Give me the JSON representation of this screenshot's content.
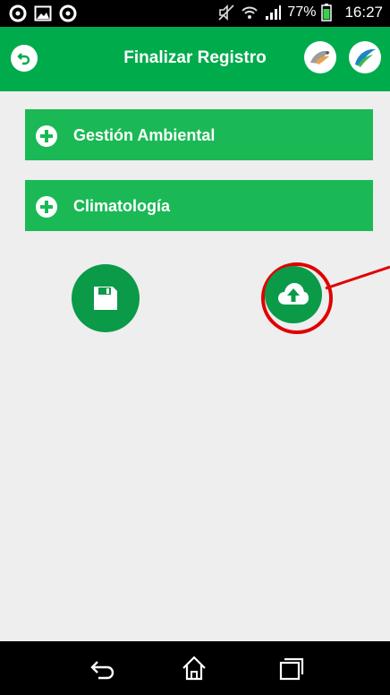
{
  "status_bar": {
    "battery_percent": "77%",
    "time": "16:27",
    "icons": [
      "notification-icon",
      "image-icon",
      "notification-icon",
      "muted-icon",
      "wifi-icon",
      "signal-icon",
      "battery-icon"
    ]
  },
  "app_bar": {
    "title": "Finalizar Registro",
    "icons": [
      "back-icon",
      "bird-logo-icon",
      "leaf-logo-icon"
    ],
    "colors": {
      "primary": "#00ab4c"
    }
  },
  "sections": [
    {
      "label": "Gestión Ambiental",
      "icon": "plus-icon"
    },
    {
      "label": "Climatología",
      "icon": "plus-icon"
    }
  ],
  "actions": {
    "save_icon": "save-icon",
    "upload_icon": "cloud-upload-icon",
    "highlight_color": "#e00000"
  },
  "nav_bar": {
    "icons": [
      "back-nav-icon",
      "home-icon",
      "recents-icon"
    ]
  }
}
